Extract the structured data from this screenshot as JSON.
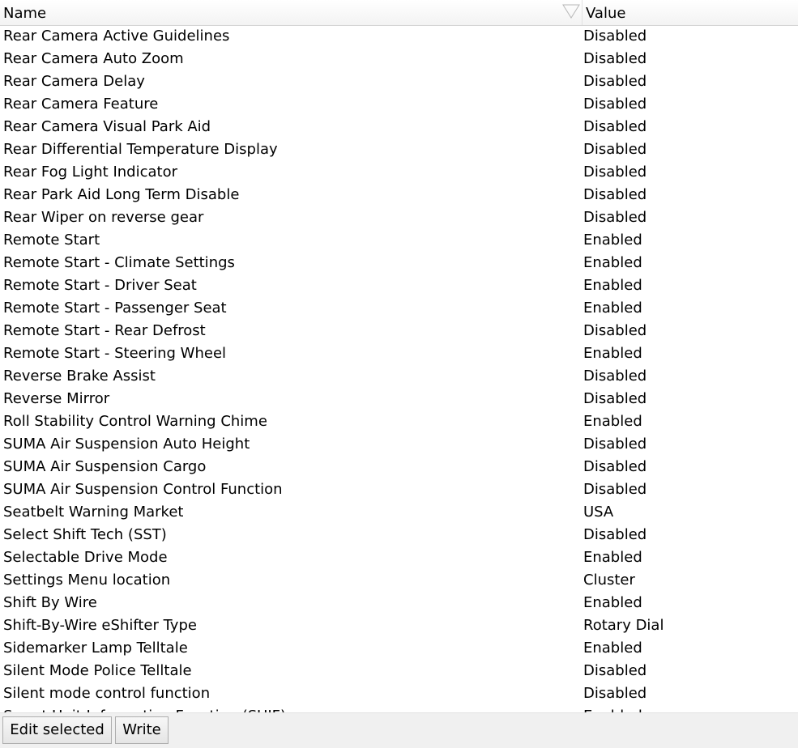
{
  "table": {
    "columns": {
      "name": "Name",
      "value": "Value"
    },
    "sort_icon": "sort-triangle-icon",
    "rows": [
      {
        "name": "Rear Camera Active Guidelines",
        "value": "Disabled"
      },
      {
        "name": "Rear Camera Auto Zoom",
        "value": "Disabled"
      },
      {
        "name": "Rear Camera Delay",
        "value": "Disabled"
      },
      {
        "name": "Rear Camera Feature",
        "value": "Disabled"
      },
      {
        "name": "Rear Camera Visual Park Aid",
        "value": "Disabled"
      },
      {
        "name": "Rear Differential Temperature Display",
        "value": "Disabled"
      },
      {
        "name": "Rear Fog Light Indicator",
        "value": "Disabled"
      },
      {
        "name": "Rear Park Aid Long Term Disable",
        "value": "Disabled"
      },
      {
        "name": "Rear Wiper on reverse gear",
        "value": "Disabled"
      },
      {
        "name": "Remote Start",
        "value": "Enabled"
      },
      {
        "name": "Remote Start - Climate Settings",
        "value": "Enabled"
      },
      {
        "name": "Remote Start - Driver Seat",
        "value": "Enabled"
      },
      {
        "name": "Remote Start - Passenger Seat",
        "value": "Enabled"
      },
      {
        "name": "Remote Start - Rear Defrost",
        "value": "Disabled"
      },
      {
        "name": "Remote Start - Steering Wheel",
        "value": "Enabled"
      },
      {
        "name": "Reverse Brake Assist",
        "value": "Disabled"
      },
      {
        "name": "Reverse Mirror",
        "value": "Disabled"
      },
      {
        "name": "Roll Stability Control Warning Chime",
        "value": "Enabled"
      },
      {
        "name": "SUMA Air Suspension Auto Height",
        "value": "Disabled"
      },
      {
        "name": "SUMA Air Suspension Cargo",
        "value": "Disabled"
      },
      {
        "name": "SUMA Air Suspension Control Function",
        "value": "Disabled"
      },
      {
        "name": "Seatbelt Warning Market",
        "value": "USA"
      },
      {
        "name": "Select Shift Tech (SST)",
        "value": "Disabled"
      },
      {
        "name": "Selectable Drive Mode",
        "value": "Enabled"
      },
      {
        "name": "Settings Menu location",
        "value": "Cluster"
      },
      {
        "name": "Shift By Wire",
        "value": "Enabled"
      },
      {
        "name": "Shift-By-Wire eShifter Type",
        "value": "Rotary Dial"
      },
      {
        "name": "Sidemarker Lamp Telltale",
        "value": "Enabled"
      },
      {
        "name": "Silent Mode Police Telltale",
        "value": "Disabled"
      },
      {
        "name": "Silent mode control function",
        "value": "Disabled"
      },
      {
        "name": "Smart Unit Information Function (SUIF)",
        "value": "Enabled"
      }
    ]
  },
  "footer": {
    "edit_label": "Edit selected",
    "write_label": "Write"
  }
}
